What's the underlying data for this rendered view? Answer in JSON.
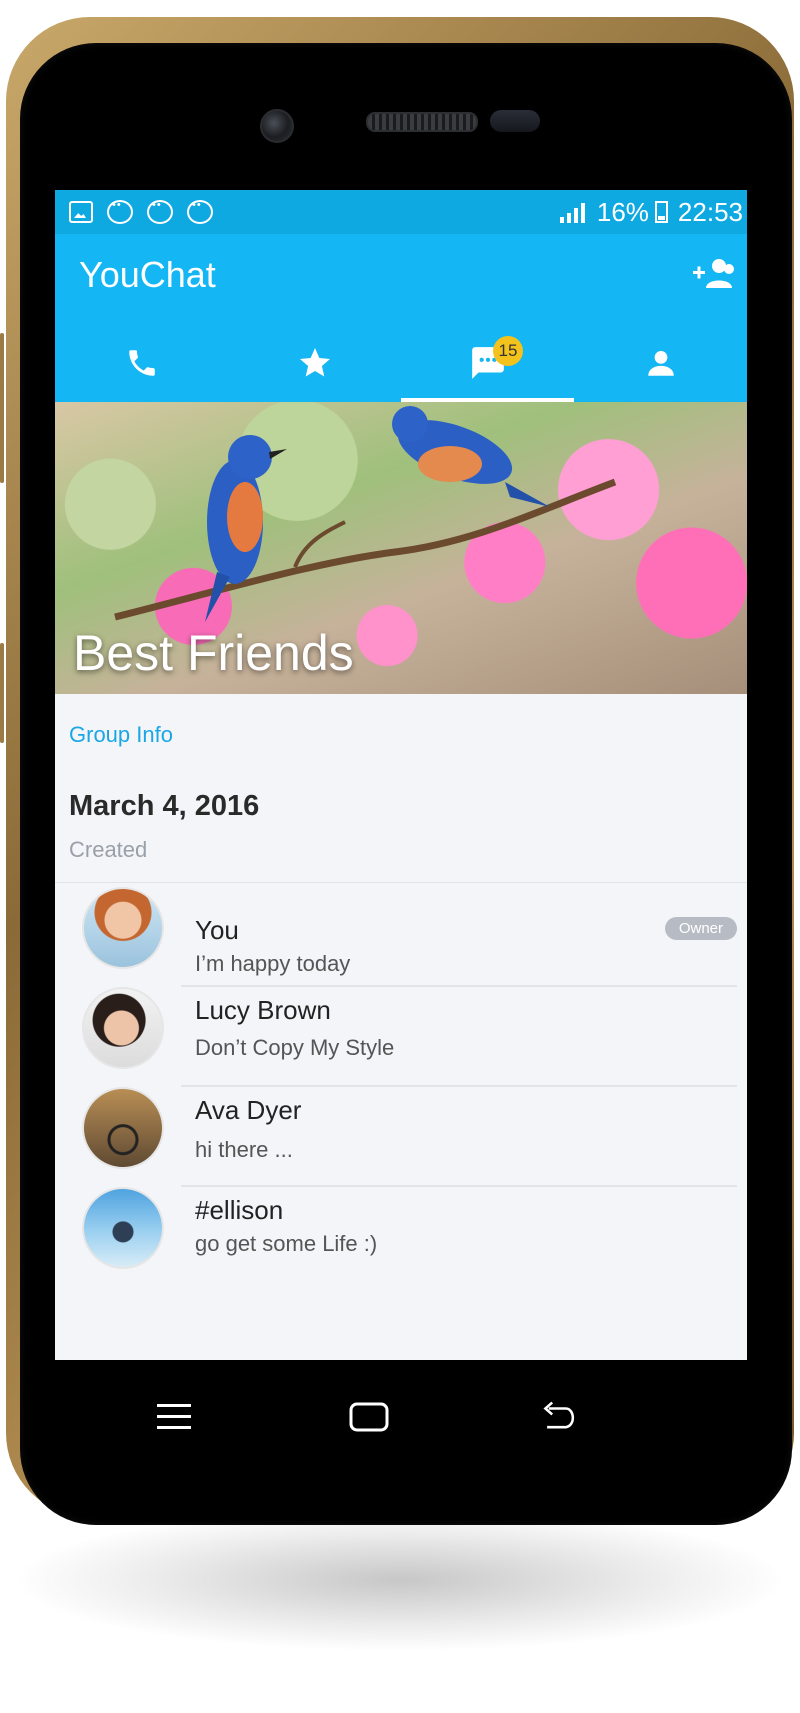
{
  "status_bar": {
    "battery": "16%",
    "time": "22:53"
  },
  "app": {
    "title": "YouChat",
    "tabs": [
      {
        "name": "calls",
        "icon": "phone-icon"
      },
      {
        "name": "favorites",
        "icon": "star-icon"
      },
      {
        "name": "chats",
        "icon": "chat-icon",
        "badge": "15",
        "active": true
      },
      {
        "name": "contacts",
        "icon": "person-icon"
      }
    ]
  },
  "group": {
    "name": "Best Friends",
    "info_label": "Group Info",
    "created_date": "March 4, 2016",
    "created_label": "Created"
  },
  "members": [
    {
      "name": "You",
      "status": "I’m  happy today",
      "role": "Owner"
    },
    {
      "name": "Lucy Brown",
      "status": "Don’t Copy My Style"
    },
    {
      "name": "Ava Dyer",
      "status": "hi there ..."
    },
    {
      "name": "#ellison",
      "status": "go get some Life :)"
    }
  ],
  "colors": {
    "status_bar": "#0fa9e2",
    "app_bar": "#14b6f3",
    "accent_link": "#1aa7e6",
    "badge": "#f4c21c",
    "frame_gold": "#b48f52"
  }
}
